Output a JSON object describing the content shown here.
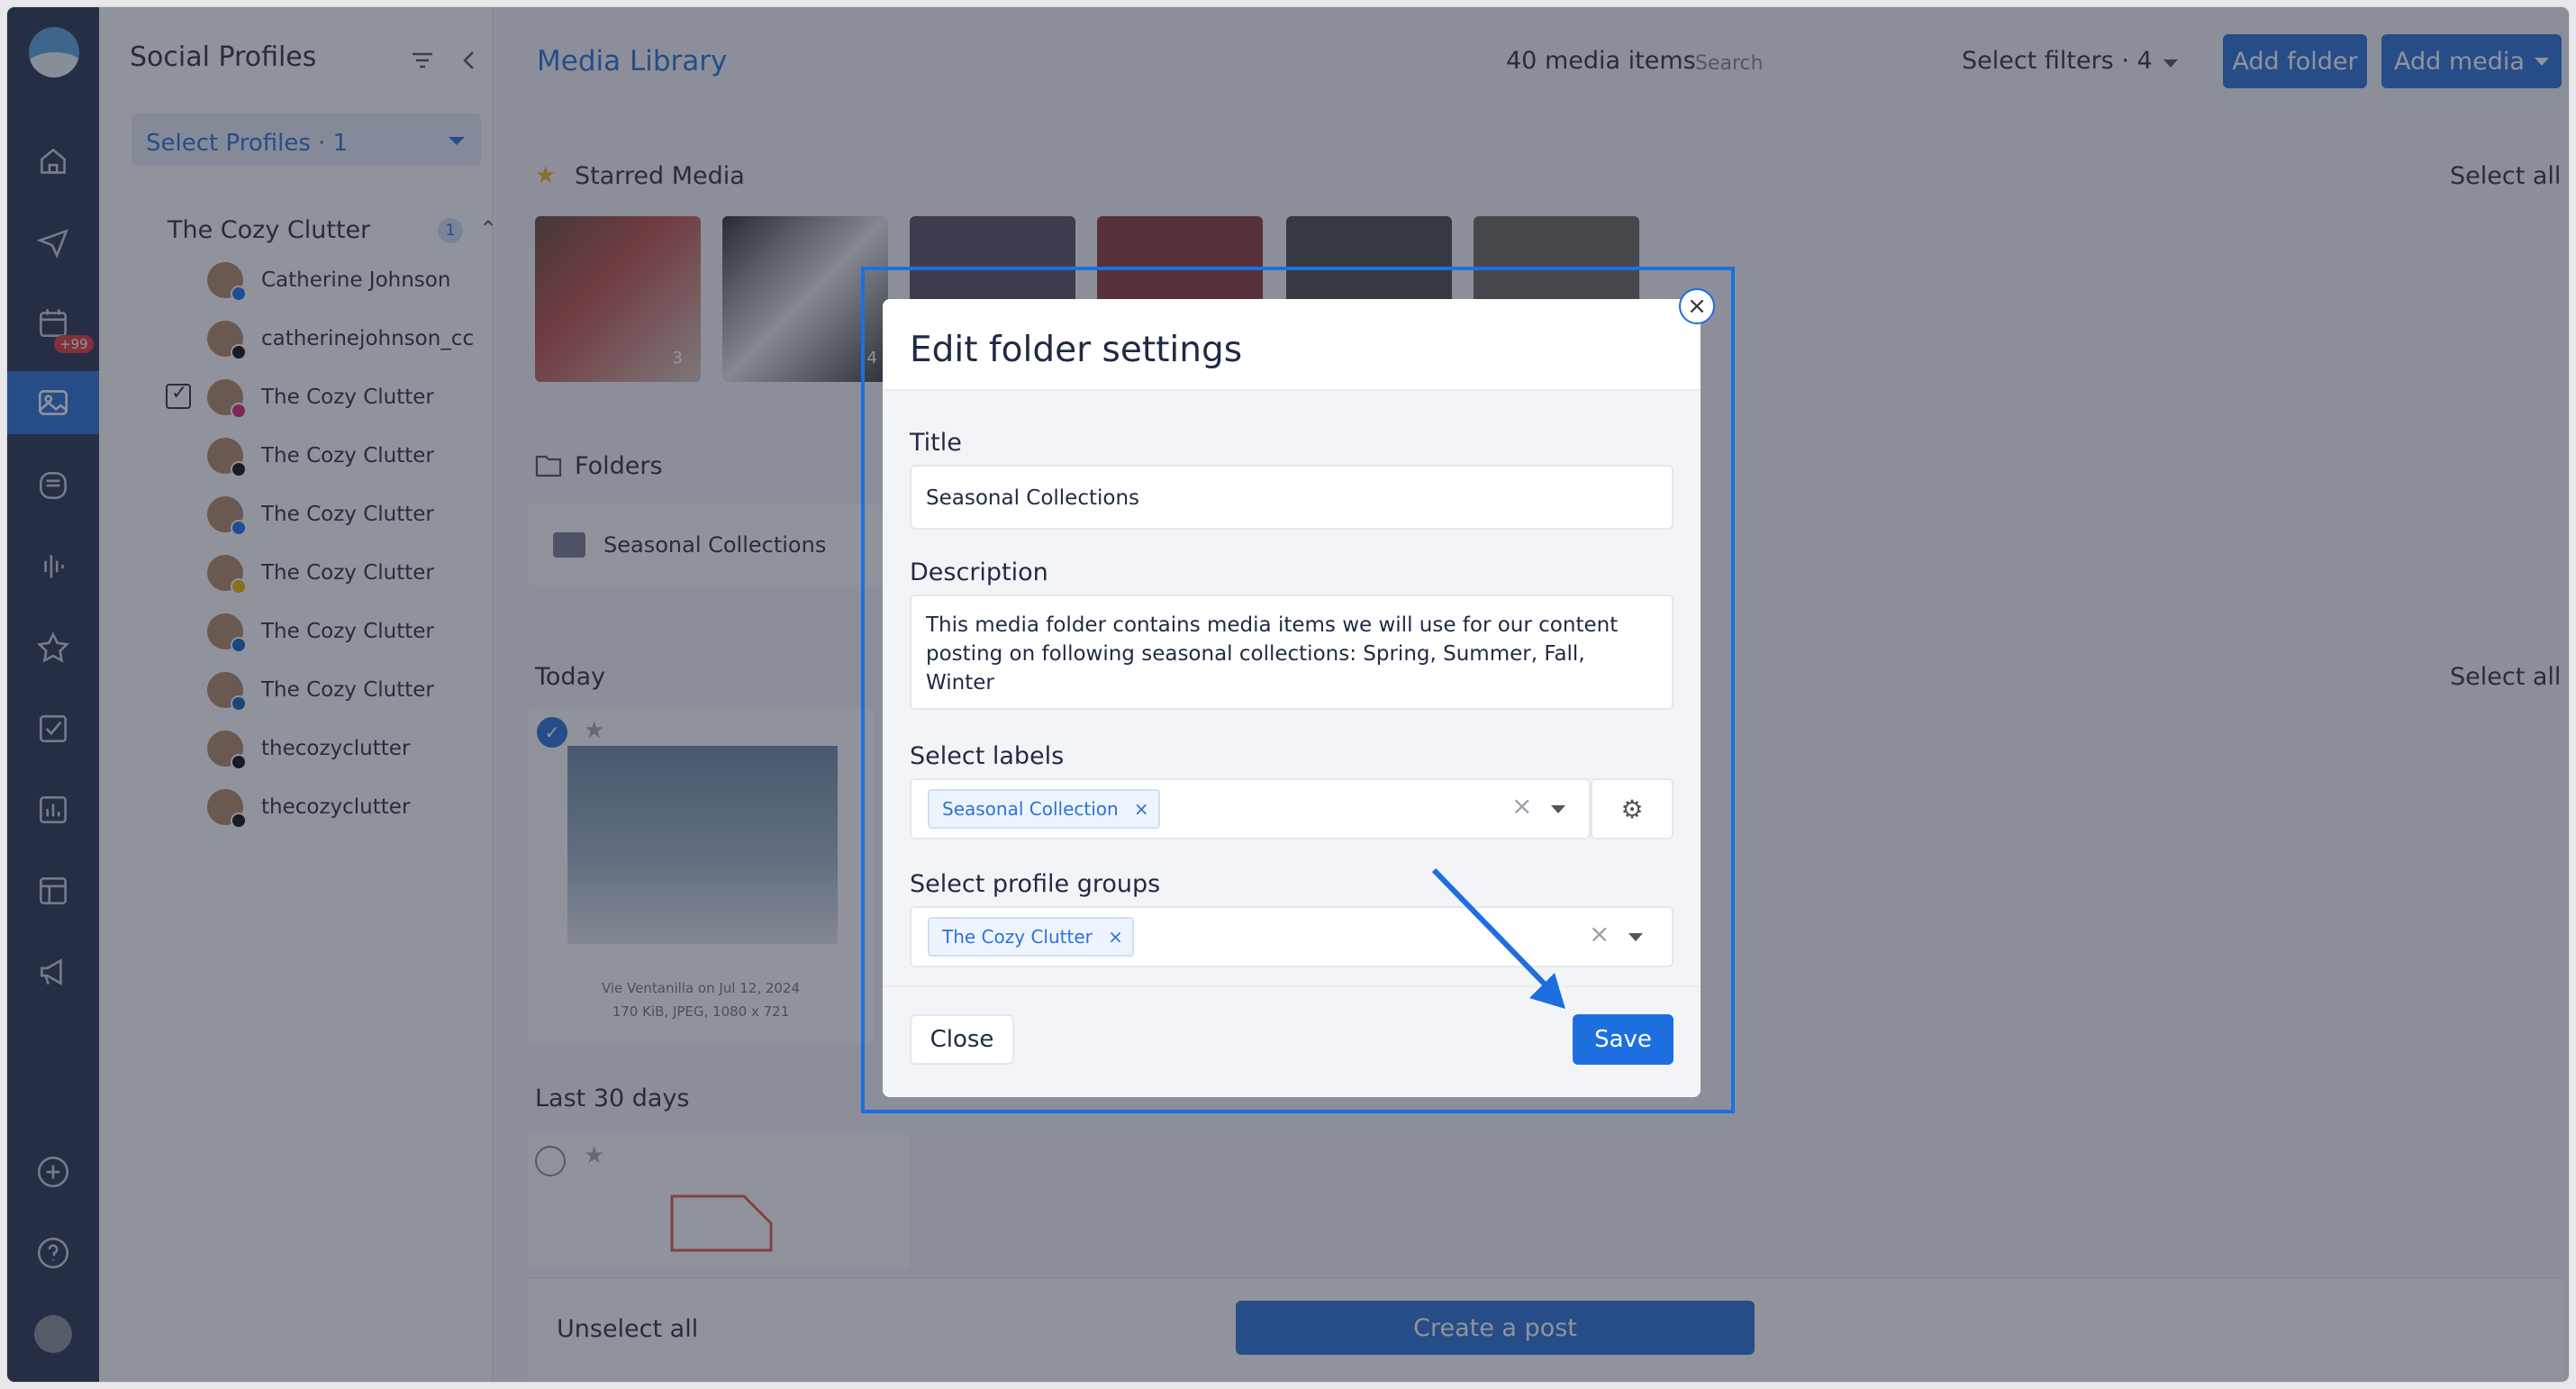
{
  "sidebar": {
    "badge": "+99",
    "items": [
      "home-icon",
      "send-icon",
      "calendar-icon",
      "media-icon",
      "inbox-icon",
      "analytics-wave-icon",
      "star-icon",
      "tasks-icon",
      "reports-icon",
      "layout-icon",
      "megaphone-icon"
    ],
    "bottom": [
      "add-icon",
      "help-icon",
      "avatar"
    ]
  },
  "profiles_panel": {
    "title": "Social Profiles",
    "select_profiles": "Select Profiles · 1",
    "group_name": "The Cozy Clutter",
    "group_count": "1",
    "profiles": [
      {
        "name": "Catherine Johnson",
        "network": "facebook"
      },
      {
        "name": "catherinejohnson_cc",
        "network": "threads"
      },
      {
        "name": "The Cozy Clutter",
        "network": "instagram",
        "checked": true
      },
      {
        "name": "The Cozy Clutter",
        "network": "x"
      },
      {
        "name": "The Cozy Clutter",
        "network": "facebook"
      },
      {
        "name": "The Cozy Clutter",
        "network": "google"
      },
      {
        "name": "The Cozy Clutter",
        "network": "linkedin"
      },
      {
        "name": "The Cozy Clutter",
        "network": "linkedin"
      },
      {
        "name": "thecozyclutter",
        "network": "tiktok"
      },
      {
        "name": "thecozyclutter",
        "network": "threads"
      }
    ]
  },
  "main": {
    "title": "Media Library",
    "count": "40 media items",
    "search_placeholder": "Search",
    "filters": "Select filters · 4",
    "add_folder": "Add folder",
    "add_media": "Add media",
    "starred": "Starred Media",
    "select_all": "Select all",
    "folders": "Folders",
    "folder_name": "Seasonal Collections",
    "today": "Today",
    "media_caption_1": "Vie Ventanilla on Jul 12, 2024",
    "media_caption_2": "170 KiB, JPEG, 1080 x 721",
    "last30": "Last 30 days",
    "unselect_all": "Unselect all",
    "create_post": "Create a post",
    "thumb_counts": [
      "3",
      "4"
    ]
  },
  "modal": {
    "title": "Edit folder settings",
    "title_label": "Title",
    "title_value": "Seasonal Collections",
    "description_label": "Description",
    "description_value": "This media folder contains media items we will use for our content posting on following seasonal collections: Spring, Summer, Fall, Winter",
    "labels_label": "Select labels",
    "label_chip": "Seasonal Collection",
    "groups_label": "Select profile groups",
    "group_chip": "The Cozy Clutter",
    "close": "Close",
    "save": "Save"
  },
  "colors": {
    "accent": "#1d6fe0",
    "nav": "#2a3553",
    "badge": "#e13a3a"
  }
}
